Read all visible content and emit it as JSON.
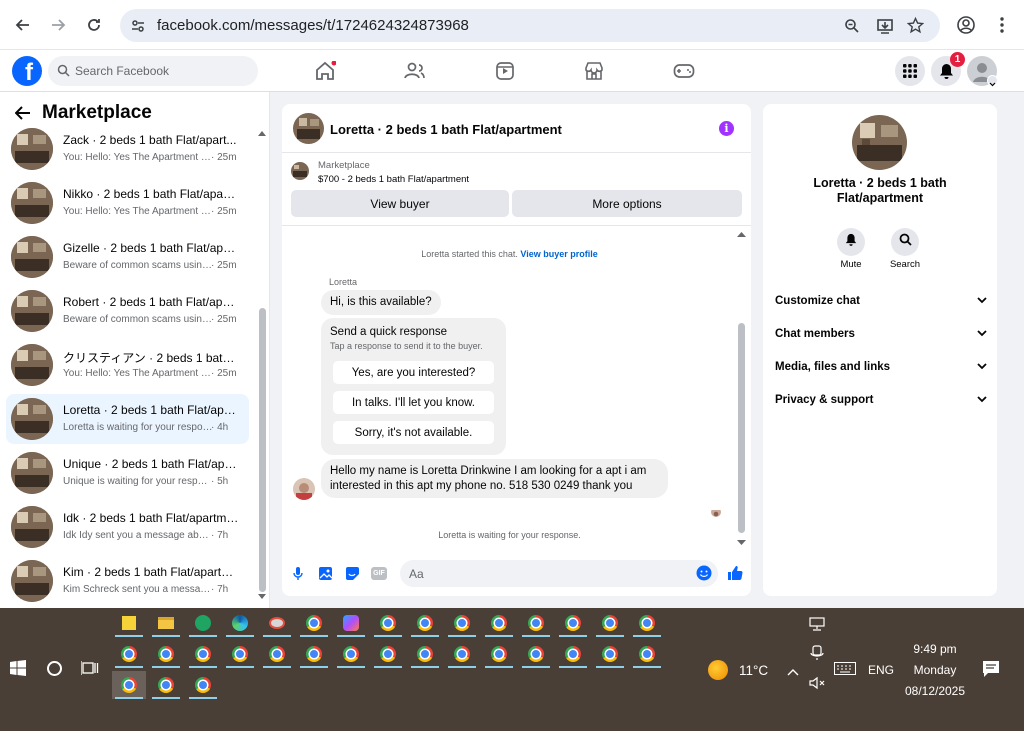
{
  "browser": {
    "url": "facebook.com/messages/t/1724624324873968"
  },
  "fb_header": {
    "search_placeholder": "Search Facebook",
    "notification_count": "1"
  },
  "sidebar": {
    "title": "Marketplace",
    "conversations": [
      {
        "title": "Zack · 2 beds 1 bath Flat/apart...",
        "preview": "You: Hello: Yes The Apartment Is ...",
        "time": "· 25m"
      },
      {
        "title": "Nikko · 2 beds 1 bath Flat/apart...",
        "preview": "You: Hello: Yes The Apartment Is ...",
        "time": "· 25m"
      },
      {
        "title": "Gizelle · 2 beds 1 bath Flat/apar...",
        "preview": "Beware of common scams using...",
        "time": "· 25m"
      },
      {
        "title": "Robert · 2 beds 1 bath Flat/apar...",
        "preview": "Beware of common scams using...",
        "time": "· 25m"
      },
      {
        "title": "クリスティアン · 2 beds 1 bath ...",
        "preview": "You: Hello: Yes The Apartment Is ...",
        "time": "· 25m"
      },
      {
        "title": "Loretta · 2 beds 1 bath Flat/apa...",
        "preview": "Loretta is waiting for your response.",
        "time": "· 4h"
      },
      {
        "title": "Unique · 2 beds 1 bath Flat/apa...",
        "preview": "Unique is waiting for your response.",
        "time": "· 5h"
      },
      {
        "title": "Idk · 2 beds 1 bath Flat/apartme...",
        "preview": "Idk Idy sent you a message about ...",
        "time": "· 7h"
      },
      {
        "title": "Kim · 2 beds 1 bath Flat/apartm...",
        "preview": "Kim Schreck sent you a message a...",
        "time": "· 7h"
      }
    ]
  },
  "chat": {
    "title": "Loretta · 2 beds 1 bath Flat/apartment",
    "listing_source": "Marketplace",
    "listing_text": "$700 - 2 beds 1 bath Flat/apartment",
    "view_buyer_label": "View buyer",
    "more_options_label": "More options",
    "started_text": "Loretta started this chat.",
    "view_buyer_profile_link": "View buyer profile",
    "sender_name": "Loretta",
    "first_message": "Hi, is this available?",
    "quick_response_title": "Send a quick response",
    "quick_response_sub": "Tap a response to send it to the buyer.",
    "quick_responses": [
      "Yes, are you interested?",
      "In talks. I'll let you know.",
      "Sorry, it's not available."
    ],
    "second_message": "Hello my name is Loretta Drinkwine I am looking for a apt i am interested in this apt my phone no. 518 530 0249 thank you",
    "waiting_text": "Loretta is waiting for your response.",
    "composer_placeholder": "Aa"
  },
  "info_panel": {
    "name": "Loretta · 2 beds 1 bath Flat/apartment",
    "mute_label": "Mute",
    "search_label": "Search",
    "sections": [
      "Customize chat",
      "Chat members",
      "Media, files and links",
      "Privacy & support"
    ]
  },
  "taskbar": {
    "temperature": "11°C",
    "language": "ENG",
    "time": "9:49 pm",
    "day": "Monday",
    "date": "08/12/2025"
  },
  "colors": {
    "fb_blue": "#0866ff",
    "selected_row": "#ebf5ff",
    "info_purple": "#a033ff",
    "taskbar": "#4a3f36"
  }
}
